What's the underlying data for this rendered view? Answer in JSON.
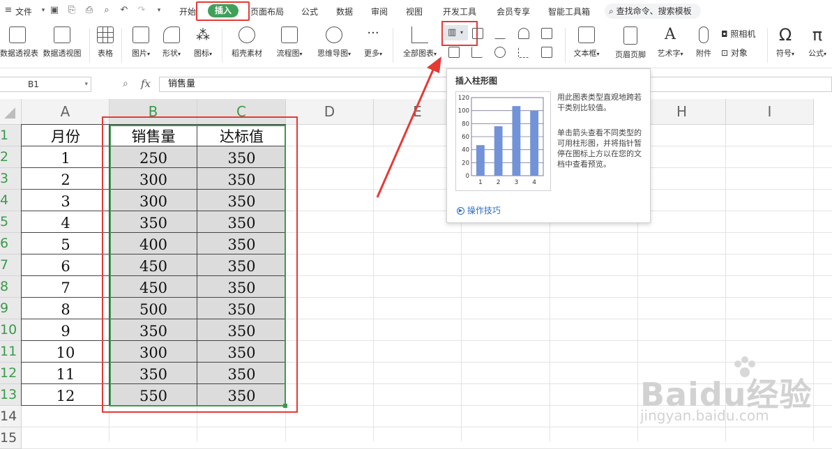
{
  "menubar": {
    "file": "文件",
    "tabs": [
      "开始",
      "插入",
      "页面布局",
      "公式",
      "数据",
      "审阅",
      "视图",
      "开发工具",
      "会员专享",
      "智能工具箱"
    ],
    "active_tab": "插入",
    "search_placeholder": "查找命令、搜索模板"
  },
  "toolbar": {
    "pivot_table": "数据透视表",
    "pivot_chart": "数据透视图",
    "table": "表格",
    "picture": "图片",
    "shape": "形状",
    "icon": "图标",
    "shell_material": "稻壳素材",
    "flowchart": "流程图",
    "mindmap": "思维导图",
    "more": "更多",
    "all_charts": "全部图表",
    "textbox": "文本框",
    "header_footer": "页眉页脚",
    "wordart": "艺术字",
    "attachment": "附件",
    "camera": "照相机",
    "object": "对象",
    "symbol": "符号",
    "formula": "公式"
  },
  "formula_bar": {
    "name_box": "B1",
    "fx_label": "fx",
    "value": "销售量"
  },
  "sheet": {
    "columns": [
      "A",
      "B",
      "C",
      "D",
      "E",
      "F",
      "G",
      "H",
      "I"
    ],
    "rows": [
      "1",
      "2",
      "3",
      "4",
      "5",
      "6",
      "7",
      "8",
      "9",
      "10",
      "11",
      "12",
      "13",
      "14",
      "15"
    ],
    "headers": [
      "月份",
      "销售量",
      "达标值"
    ],
    "data": [
      [
        "1",
        "250",
        "350"
      ],
      [
        "2",
        "300",
        "350"
      ],
      [
        "3",
        "300",
        "350"
      ],
      [
        "4",
        "350",
        "350"
      ],
      [
        "5",
        "400",
        "350"
      ],
      [
        "6",
        "450",
        "350"
      ],
      [
        "7",
        "450",
        "350"
      ],
      [
        "8",
        "500",
        "350"
      ],
      [
        "9",
        "350",
        "350"
      ],
      [
        "10",
        "300",
        "350"
      ],
      [
        "11",
        "350",
        "350"
      ],
      [
        "12",
        "550",
        "350"
      ]
    ]
  },
  "tooltip": {
    "title": "插入柱形图",
    "desc1": "用此图表类型直观地跨若干类别比较值。",
    "desc2": "单击箭头查看不同类型的可用柱形图，并将指针暂停在图标上方以在您的文档中查看预览。",
    "tips_link": "操作技巧"
  },
  "chart_data": {
    "type": "bar",
    "categories": [
      "1",
      "2",
      "3",
      "4"
    ],
    "values": [
      47,
      76,
      107,
      100
    ],
    "ylim": [
      0,
      120
    ],
    "yticks": [
      "0",
      "20",
      "40",
      "60",
      "80",
      "100",
      "120"
    ],
    "color": "#7393d8"
  },
  "watermark": {
    "brand": "Baidu经验",
    "url": "jingyan.baidu.com"
  },
  "colors": {
    "accent_green": "#40a05a",
    "highlight_red": "#e53935",
    "selection_green": "#3a9a4b"
  }
}
